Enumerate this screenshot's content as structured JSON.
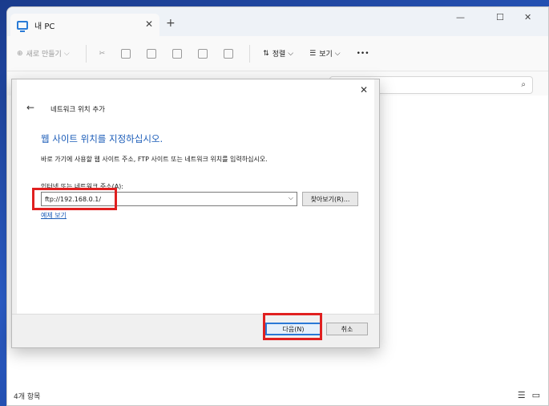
{
  "explorer": {
    "tab_title": "내 PC",
    "new_tab": "+",
    "tab_close": "✕",
    "win_min": "—",
    "win_max": "☐",
    "win_close": "✕"
  },
  "toolbar": {
    "new_label": "새로 만들기",
    "new_caret": "⌵",
    "sort_label": "정렬",
    "sort_caret": "⌵",
    "view_label": "보기",
    "view_caret": "⌵",
    "more": "•••"
  },
  "status": {
    "item_count": "4개 항목"
  },
  "dialog": {
    "title": "네트워크 위치 추가",
    "heading": "웹 사이트 위치를 지정하십시오.",
    "description": "바로 가기에 사용할 웹 사이트 주소, FTP 사이트 또는 네트워크 위치를 입력하십시오.",
    "address_label": "인터넷 또는 네트워크 주소(A):",
    "address_value": "ftp://192.168.0.1/",
    "browse_button": "찾아보기(R)...",
    "example_link": "예제 보기",
    "next_button": "다음(N)",
    "cancel_button": "취소"
  },
  "colors": {
    "accent": "#1b5cb8",
    "highlight": "#e02020"
  }
}
